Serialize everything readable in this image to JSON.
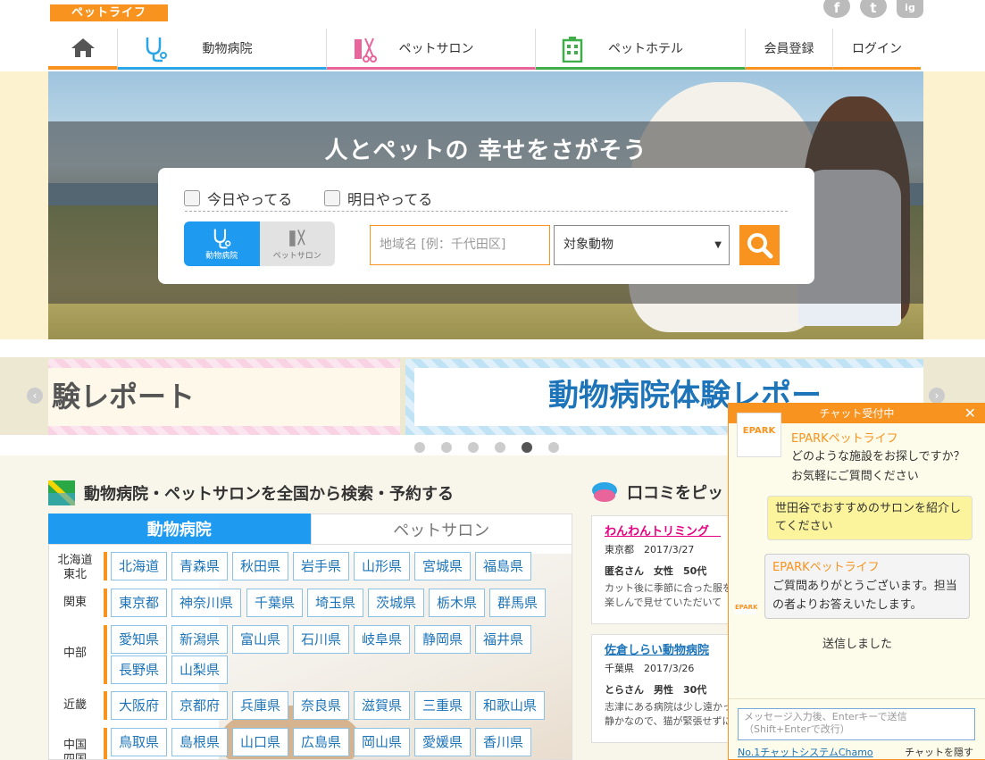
{
  "brand": {
    "logo": "ペットライフ",
    "accent": "#f7931e"
  },
  "social": [
    "f",
    "t",
    "ig"
  ],
  "nav": {
    "home": "home",
    "vet": "動物病院",
    "salon": "ペットサロン",
    "hotel": "ペットホテル",
    "register": "会員登録",
    "login": "ログイン"
  },
  "hero": {
    "headline": "人とペットの 幸せをさがそう"
  },
  "search": {
    "today": "今日やってる",
    "tomorrow": "明日やってる",
    "seg_vet": "動物病院",
    "seg_salon": "ペットサロン",
    "area_placeholder": "地域名 [例：千代田区]",
    "animal": "対象動物"
  },
  "banners": {
    "left": "験レポート",
    "right": "動物病院体験レポー"
  },
  "section": {
    "nation_title": "動物病院・ペットサロンを全国から検索・予約する",
    "review_title": "口コミをピッ"
  },
  "tabs": {
    "vet": "動物病院",
    "salon": "ペットサロン"
  },
  "regions": [
    {
      "name": "北海道\n東北",
      "prefs": [
        "北海道",
        "青森県",
        "秋田県",
        "岩手県",
        "山形県",
        "宮城県",
        "福島県"
      ]
    },
    {
      "name": "関東",
      "prefs": [
        "東京都",
        "神奈川県",
        "千葉県",
        "埼玉県",
        "茨城県",
        "栃木県",
        "群馬県"
      ]
    },
    {
      "name": "中部",
      "prefs": [
        "愛知県",
        "新潟県",
        "富山県",
        "石川県",
        "岐阜県",
        "静岡県",
        "福井県",
        "長野県",
        "山梨県"
      ]
    },
    {
      "name": "近畿",
      "prefs": [
        "大阪府",
        "京都府",
        "兵庫県",
        "奈良県",
        "滋賀県",
        "三重県",
        "和歌山県"
      ]
    },
    {
      "name": "中国\n四国",
      "prefs": [
        "鳥取県",
        "島根県",
        "山口県",
        "広島県",
        "岡山県",
        "愛媛県",
        "香川県"
      ]
    }
  ],
  "reviews": [
    {
      "title": "わんわんトリミング　",
      "meta": "東京都　2017/3/27",
      "user": "匿名さん　女性　50代",
      "body1": "カット後に季節に合った服を",
      "body2": "楽しんで見せていただいて"
    },
    {
      "title": "佐倉しらい動物病院",
      "meta": "千葉県　2017/3/26",
      "user": "とらさん　男性　30代",
      "body1": "志津にある病院は少し遠かっ",
      "body2": "静かなので、猫が緊張せずに"
    }
  ],
  "chat": {
    "header": "チャット受付中",
    "close": "✕",
    "logo": "EPARK",
    "bot": "EPARKペットライフ",
    "greet1": "どのような施設をお探しですか？",
    "greet2": "お気軽にご質問ください",
    "user_msg1": "世田谷でおすすめのサロンを紹介し",
    "user_msg2": "てください",
    "reply_name": "EPARKペットライフ",
    "reply1": "ご質問ありがとうございます。担当",
    "reply2": "の者よりお答えいたします。",
    "sent": "送信しました",
    "input_placeholder1": "メッセージ入力後、Enterキーで送信",
    "input_placeholder2": "（Shift+Enterで改行）",
    "powered": "No.1チャットシステムChamo",
    "hide": "チャットを隠す"
  }
}
